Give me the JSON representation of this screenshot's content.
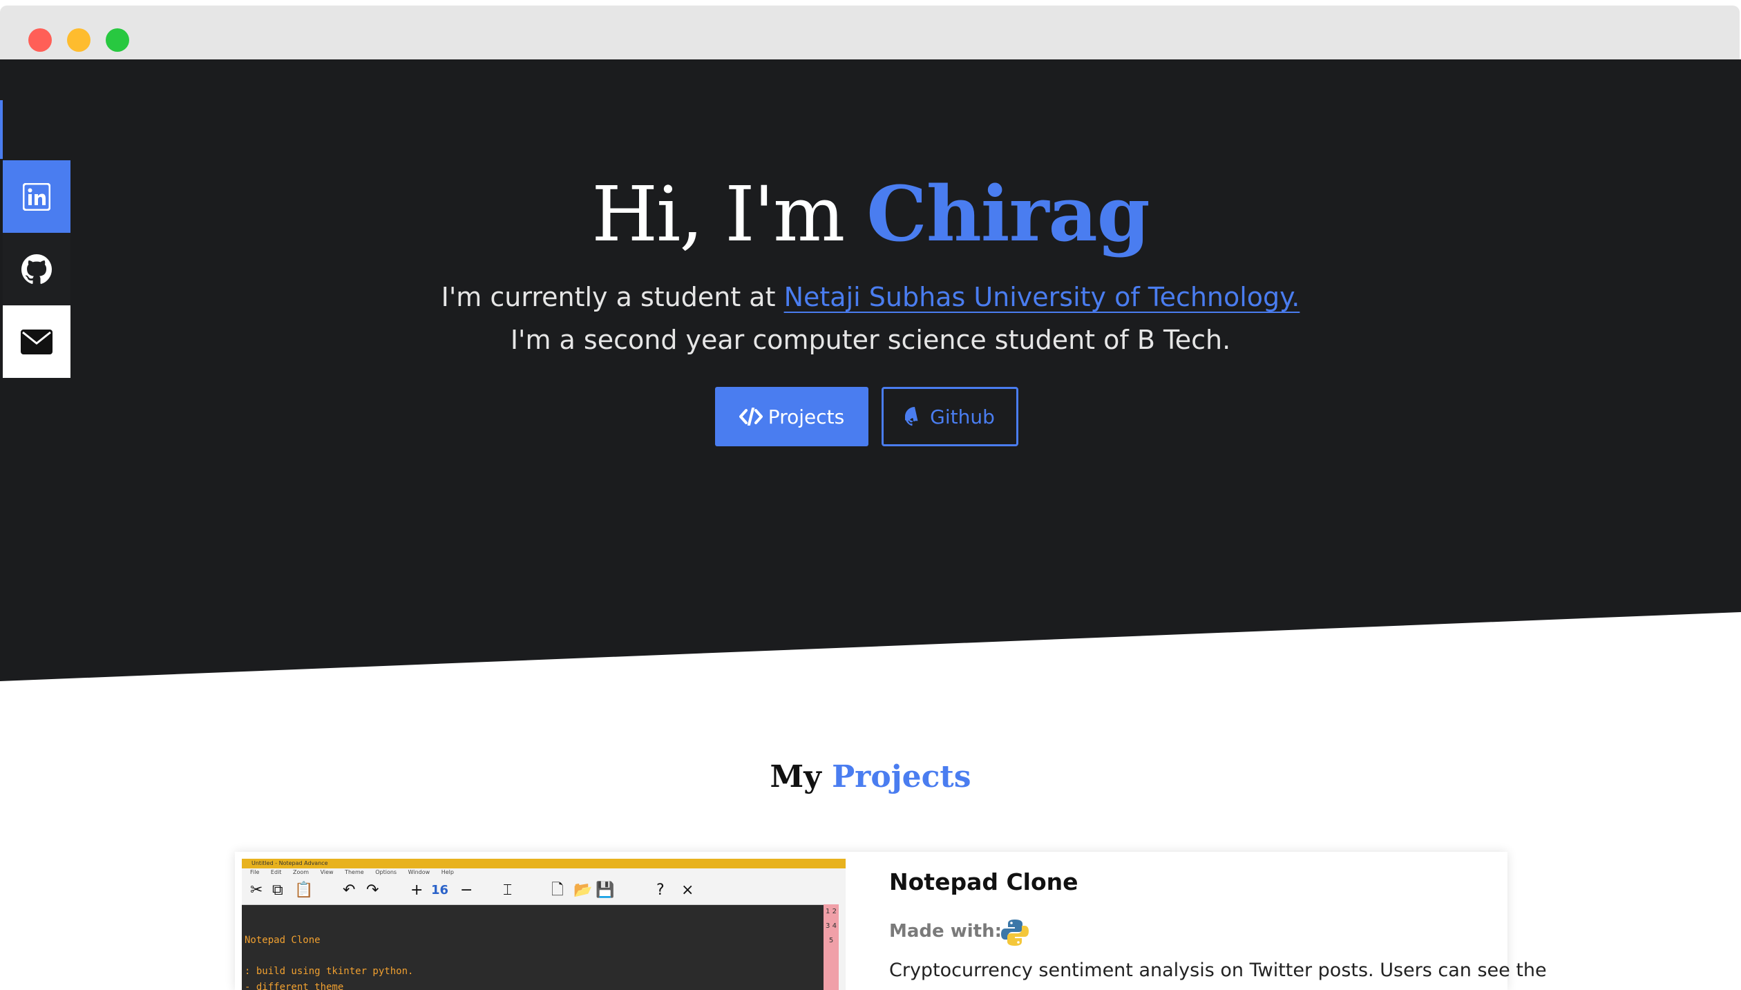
{
  "hero": {
    "greeting": "Hi, I'm ",
    "name": "Chirag",
    "line1_prefix": "I'm currently a student at ",
    "university_link": "Netaji Subhas University of Technology.",
    "line2": "I'm a second year computer science student of B Tech.",
    "projects_button": "Projects",
    "github_button": "Github"
  },
  "social": {
    "items": [
      {
        "name": "LinkedIn",
        "icon": "linkedin-icon"
      },
      {
        "name": "GitHub",
        "icon": "github-icon"
      },
      {
        "name": "Email",
        "icon": "mail-icon"
      }
    ]
  },
  "projects": {
    "heading_part1": "My ",
    "heading_part2": "Projects",
    "items": [
      {
        "title": "Notepad Clone",
        "made_with_label": "Made with:",
        "made_with_icon": "python-icon",
        "description": "Cryptocurrency sentiment analysis on Twitter posts. Users can see the",
        "screenshot": {
          "window_title": "Untitled - Notepad Advance",
          "menu": "File Edit Zoom View Theme Options Window Help",
          "font_size": "16",
          "line1": "Notepad Clone",
          "line2": ": build using tkinter python.",
          "line3": "- different theme",
          "line_numbers": "1 2 3 4 5"
        }
      }
    ]
  },
  "colors": {
    "accent": "#4a7df0",
    "hero_bg": "#1b1c1e"
  }
}
